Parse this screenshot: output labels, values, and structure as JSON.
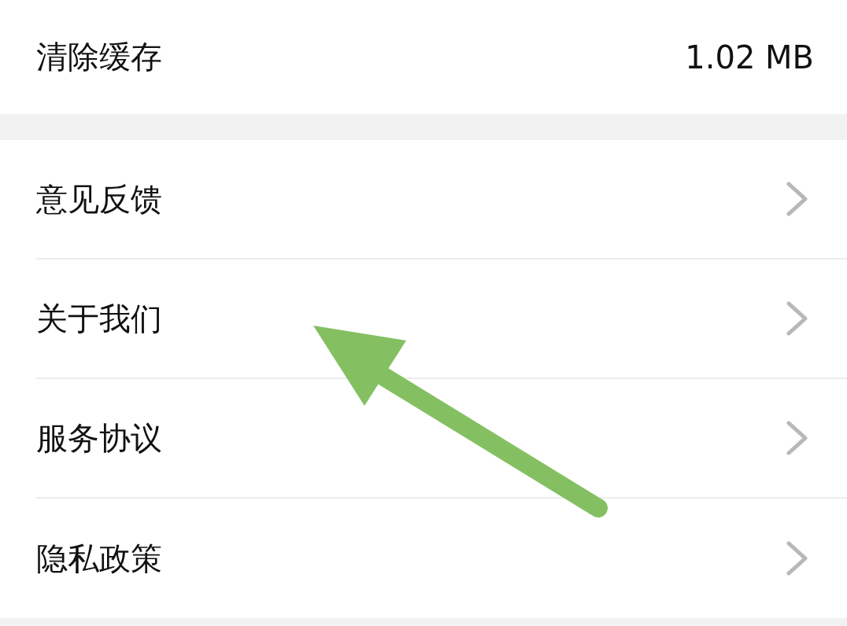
{
  "cache_row": {
    "label": "清除缓存",
    "value": "1.02 MB"
  },
  "menu_items": [
    {
      "label": "意见反馈"
    },
    {
      "label": "关于我们"
    },
    {
      "label": "服务协议"
    },
    {
      "label": "隐私政策"
    }
  ]
}
